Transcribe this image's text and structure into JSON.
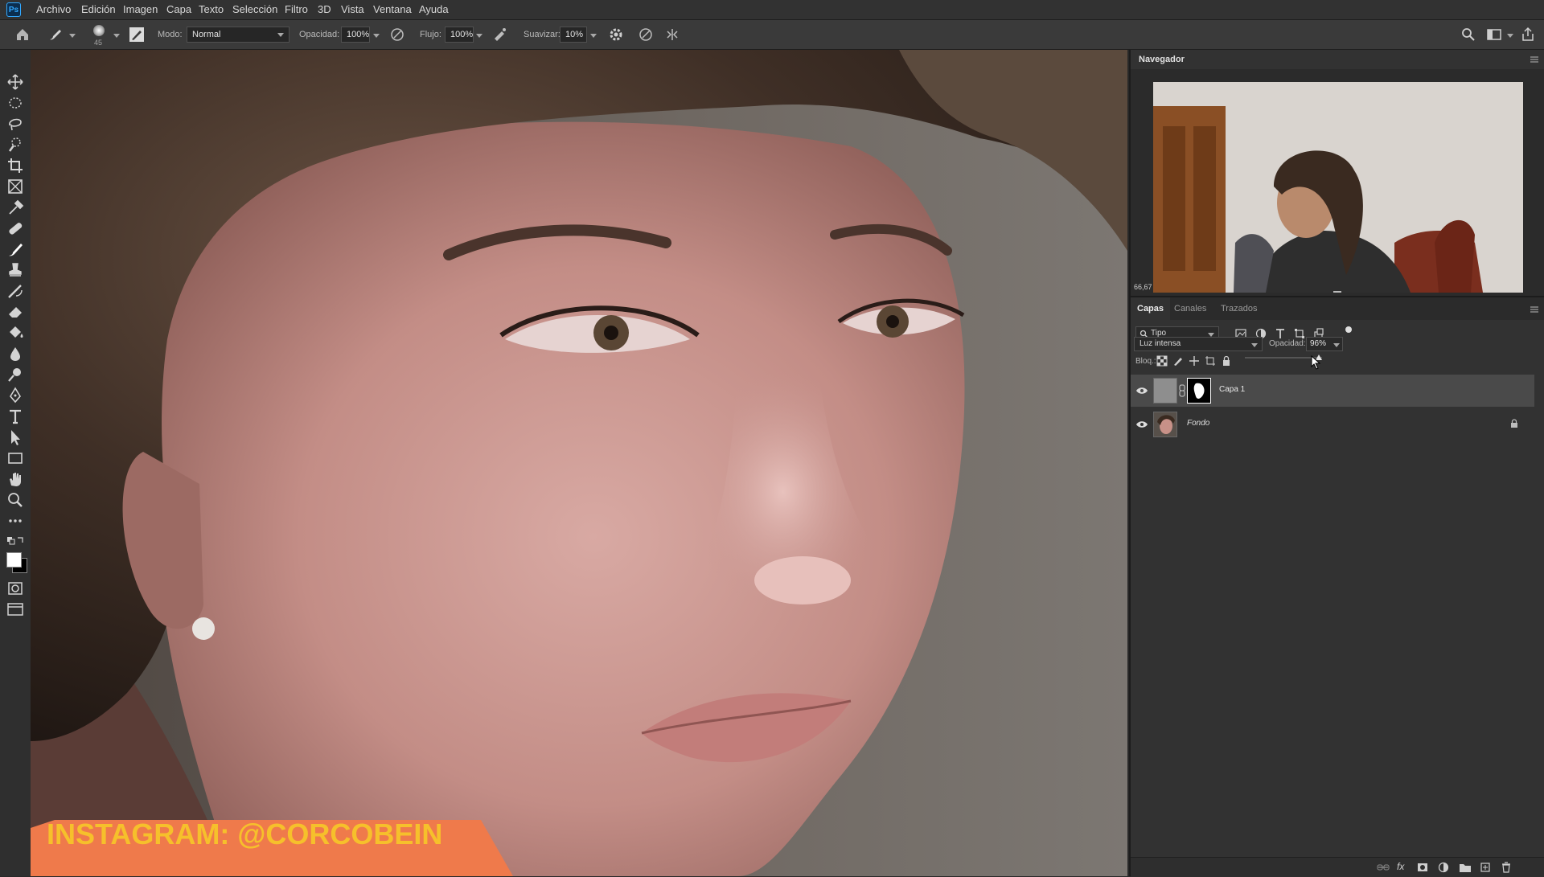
{
  "app": {
    "logo": "Ps"
  },
  "menu": [
    "Archivo",
    "Edición",
    "Imagen",
    "Capa",
    "Texto",
    "Selección",
    "Filtro",
    "3D",
    "Vista",
    "Ventana",
    "Ayuda"
  ],
  "options": {
    "brush_size": "45",
    "mode_label": "Modo:",
    "mode_value": "Normal",
    "opacity_label": "Opacidad:",
    "opacity_value": "100%",
    "flow_label": "Flujo:",
    "flow_value": "100%",
    "smoothing_label": "Suavizar:",
    "smoothing_value": "10%"
  },
  "navigator": {
    "title": "Navegador",
    "zoom": "66,67"
  },
  "layers_panel": {
    "tabs": [
      "Capas",
      "Canales",
      "Trazados"
    ],
    "active_tab": 0,
    "filter_value": "Tipo",
    "blend_mode": "Luz intensa",
    "opacity_label": "Opacidad:",
    "opacity_value": "96%",
    "opacity_level": 0.96,
    "lock_label": "Bloq.:",
    "layers": [
      {
        "name": "Capa 1",
        "selected": true,
        "visible": true,
        "locked": false
      },
      {
        "name": "Fondo",
        "selected": false,
        "visible": true,
        "locked": true
      }
    ]
  },
  "overlay": {
    "instagram_text": "INSTAGRAM: @CORCOBEIN"
  },
  "colors": {
    "accent": "#31a8ff",
    "overlay_text": "#f6c02b",
    "overlay_shape": "#ef7a4b"
  }
}
